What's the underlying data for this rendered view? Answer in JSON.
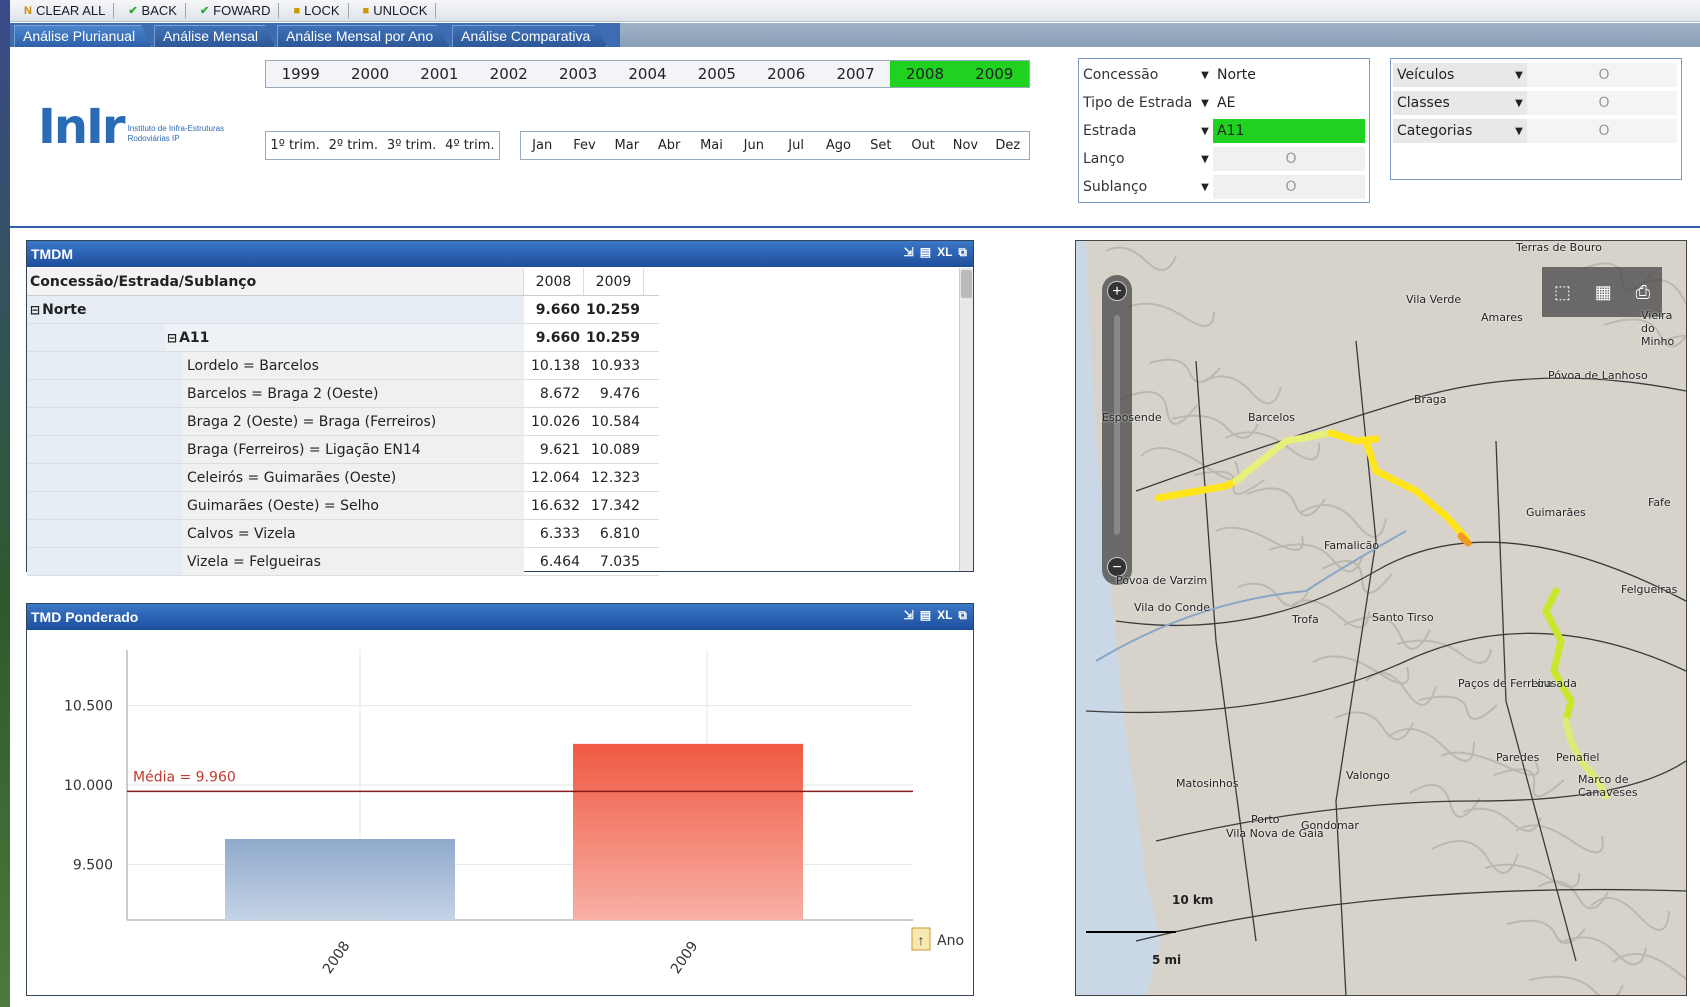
{
  "toolbar": {
    "clear_all": "CLEAR ALL",
    "back": "BACK",
    "forward": "FOWARD",
    "lock": "LOCK",
    "unlock": "UNLOCK"
  },
  "tabs": [
    {
      "label": "Análise Plurianual"
    },
    {
      "label": "Análise Mensal"
    },
    {
      "label": "Análise Mensal por Ano"
    },
    {
      "label": "Análise Comparativa"
    }
  ],
  "logo": {
    "text": "InIr",
    "subtitle1": "Instituto de Infra-Estruturas",
    "subtitle2": "Rodoviárias IP"
  },
  "years": [
    {
      "label": "1999",
      "selected": false
    },
    {
      "label": "2000",
      "selected": false
    },
    {
      "label": "2001",
      "selected": false
    },
    {
      "label": "2002",
      "selected": false
    },
    {
      "label": "2003",
      "selected": false
    },
    {
      "label": "2004",
      "selected": false
    },
    {
      "label": "2005",
      "selected": false
    },
    {
      "label": "2006",
      "selected": false
    },
    {
      "label": "2007",
      "selected": false
    },
    {
      "label": "2008",
      "selected": true
    },
    {
      "label": "2009",
      "selected": true
    }
  ],
  "trimesters": [
    "1º trim.",
    "2º trim.",
    "3º trim.",
    "4º trim."
  ],
  "months": [
    "Jan",
    "Fev",
    "Mar",
    "Abr",
    "Mai",
    "Jun",
    "Jul",
    "Ago",
    "Set",
    "Out",
    "Nov",
    "Dez"
  ],
  "filters": [
    {
      "label": "Concessão",
      "value": "Norte",
      "highlight": false,
      "empty": false
    },
    {
      "label": "Tipo de Estrada",
      "value": "AE",
      "highlight": false,
      "empty": false
    },
    {
      "label": "Estrada",
      "value": "A11",
      "highlight": true,
      "empty": false
    },
    {
      "label": "Lanço",
      "value": "O",
      "highlight": false,
      "empty": true
    },
    {
      "label": "Sublanço",
      "value": "O",
      "highlight": false,
      "empty": true
    }
  ],
  "filters2": [
    {
      "label": "Veículos",
      "value": "O"
    },
    {
      "label": "Classes",
      "value": "O"
    },
    {
      "label": "Categorias",
      "value": "O"
    }
  ],
  "tmdm": {
    "title": "TMDM",
    "header": "Concessão/Estrada/Sublanço",
    "years": [
      "2008",
      "2009"
    ],
    "rows": [
      {
        "label": "Norte",
        "v2008": "9.660",
        "v2009": "10.259",
        "level": 0,
        "bold": true,
        "toggle": "⊟"
      },
      {
        "label": "A11",
        "v2008": "9.660",
        "v2009": "10.259",
        "level": 1,
        "bold": true,
        "toggle": "⊟"
      },
      {
        "label": "Lordelo = Barcelos",
        "v2008": "10.138",
        "v2009": "10.933",
        "level": 2,
        "bold": false,
        "toggle": ""
      },
      {
        "label": "Barcelos = Braga 2 (Oeste)",
        "v2008": "8.672",
        "v2009": "9.476",
        "level": 2,
        "bold": false,
        "toggle": ""
      },
      {
        "label": "Braga 2 (Oeste) = Braga (Ferreiros)",
        "v2008": "10.026",
        "v2009": "10.584",
        "level": 2,
        "bold": false,
        "toggle": ""
      },
      {
        "label": "Braga (Ferreiros) = Ligação EN14",
        "v2008": "9.621",
        "v2009": "10.089",
        "level": 2,
        "bold": false,
        "toggle": ""
      },
      {
        "label": "Celeirós = Guimarães (Oeste)",
        "v2008": "12.064",
        "v2009": "12.323",
        "level": 2,
        "bold": false,
        "toggle": ""
      },
      {
        "label": "Guimarães (Oeste) = Selho",
        "v2008": "16.632",
        "v2009": "17.342",
        "level": 2,
        "bold": false,
        "toggle": ""
      },
      {
        "label": "Calvos = Vizela",
        "v2008": "6.333",
        "v2009": "6.810",
        "level": 2,
        "bold": false,
        "toggle": ""
      },
      {
        "label": "Vizela = Felgueiras",
        "v2008": "6.464",
        "v2009": "7.035",
        "level": 2,
        "bold": false,
        "toggle": ""
      }
    ]
  },
  "tmdp": {
    "title": "TMD Ponderado",
    "axis_label": "Ano"
  },
  "chart_data": {
    "type": "bar",
    "categories": [
      "2008",
      "2009"
    ],
    "values": [
      9660,
      10259
    ],
    "bar_colors": [
      "#a9bcd6",
      "#f27a66"
    ],
    "ylim": [
      9150,
      10850
    ],
    "yticks": [
      "9.500",
      "10.000",
      "10.500"
    ],
    "ytick_values": [
      9500,
      10000,
      10500
    ],
    "reference_line": {
      "value": 9960,
      "label": "Média = 9.960",
      "color": "#8b1a1a"
    },
    "xlabel": "Ano"
  },
  "map": {
    "labels": [
      "Terras de Bouro",
      "Vila Verde",
      "Amares",
      "Vieira do Minho",
      "Póvoa de Lanhoso",
      "Braga",
      "Barcelos",
      "Esposende",
      "Guimarães",
      "Fafe",
      "Famalicão",
      "Póvoa de Varzim",
      "Vila do Conde",
      "Trofa",
      "Santo Tirso",
      "Felgueiras",
      "Paços de Ferreira",
      "Lousada",
      "Paredes",
      "Penafiel",
      "Marco de Canaveses",
      "Valongo",
      "Matosinhos",
      "Porto",
      "Vila Nova de Gaia",
      "Gondomar"
    ],
    "scale_km": "10 km",
    "scale_mi": "5 mi"
  }
}
